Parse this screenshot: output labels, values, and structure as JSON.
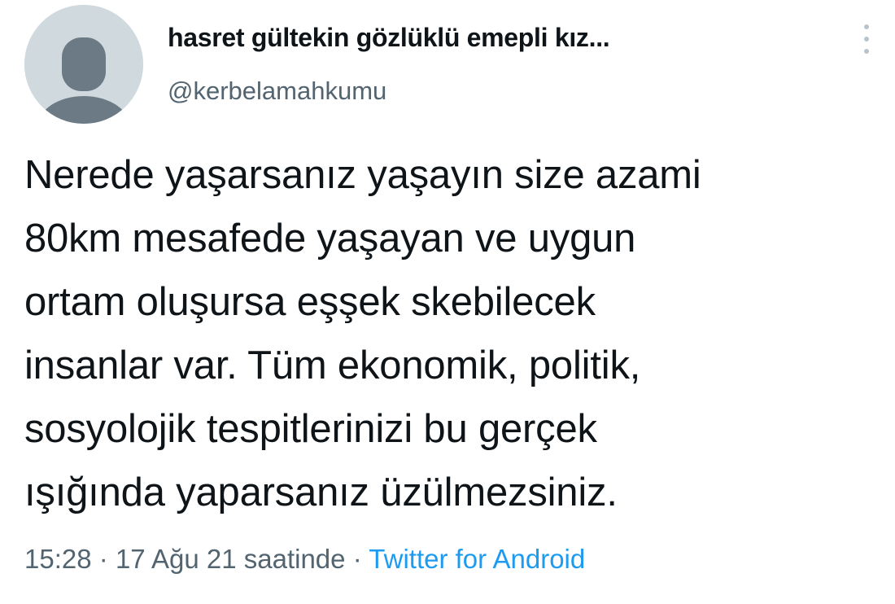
{
  "author": {
    "display_name": "hasret gültekin gözlüklü emepli kız...",
    "handle": "@kerbelamahkumu",
    "avatar_icon": "default-profile-icon"
  },
  "more_icon": "more-vertical-icon",
  "tweet": {
    "lines": [
      "Nerede yaşarsanız yaşayın size azami",
      "80km mesafede yaşayan ve uygun",
      "ortam oluşursa eşşek skebilecek",
      "insanlar var. Tüm ekonomik, politik,",
      "sosyolojik tespitlerinizi bu gerçek",
      "ışığında yaparsanız üzülmezsiniz."
    ]
  },
  "meta": {
    "time": "15:28",
    "separator": "·",
    "date": "17 Ağu 21 saatinde",
    "source": "Twitter for Android"
  },
  "colors": {
    "text": "#0f1419",
    "muted": "#536471",
    "link": "#1d9bf0",
    "avatar_bg": "#cfd9de",
    "avatar_figure": "#6c7a85"
  }
}
